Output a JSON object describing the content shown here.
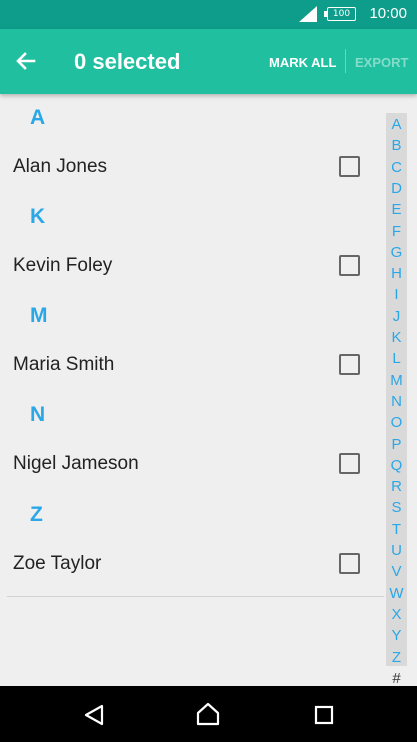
{
  "status_bar": {
    "time": "10:00",
    "battery": "100"
  },
  "app_bar": {
    "title": "0 selected",
    "mark_all": "MARK ALL",
    "export": "EXPORT"
  },
  "sections": [
    {
      "letter": "A",
      "contact": "Alan Jones",
      "checked": false
    },
    {
      "letter": "K",
      "contact": "Kevin Foley",
      "checked": false
    },
    {
      "letter": "M",
      "contact": "Maria Smith",
      "checked": false
    },
    {
      "letter": "N",
      "contact": "Nigel Jameson",
      "checked": false
    },
    {
      "letter": "Z",
      "contact": "Zoe Taylor",
      "checked": false
    }
  ],
  "index": [
    "A",
    "B",
    "C",
    "D",
    "E",
    "F",
    "G",
    "H",
    "I",
    "J",
    "K",
    "L",
    "M",
    "N",
    "O",
    "P",
    "Q",
    "R",
    "S",
    "T",
    "U",
    "V",
    "W",
    "X",
    "Y",
    "Z"
  ],
  "index_extra": "#",
  "colors": {
    "status_bar": "#0f9d8b",
    "app_bar": "#20bf9f",
    "accent": "#2aa7e7"
  }
}
